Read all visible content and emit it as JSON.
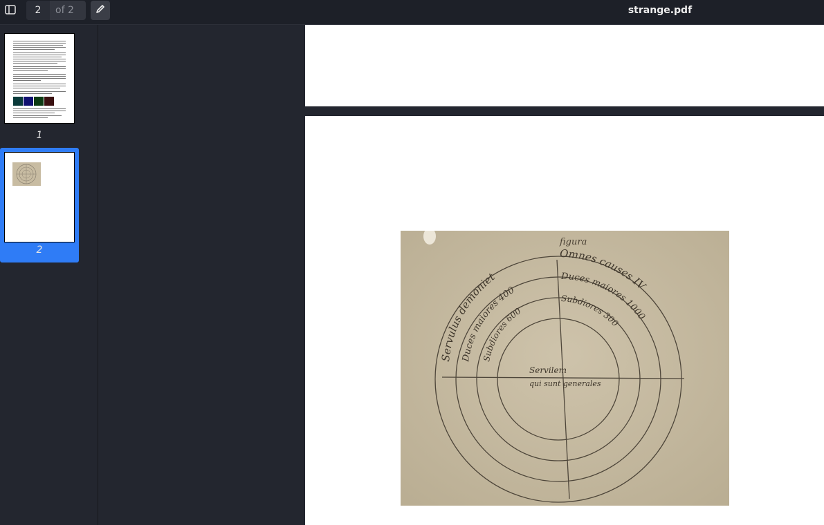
{
  "toolbar": {
    "current_page": "2",
    "page_count_label": "of 2",
    "document_title": "strange.pdf"
  },
  "sidebar": {
    "thumbnails": [
      {
        "label": "1",
        "selected": false
      },
      {
        "label": "2",
        "selected": true
      }
    ]
  },
  "document": {
    "figure_heading": "figura",
    "circle_text": {
      "outer_top_right": "Omnes causes IV",
      "outer_top_left": "Servulus demoniet",
      "ring2_top_right": "Duces maiores 1000",
      "ring2_top_left": "Duces maiores 400",
      "ring3_top_right": "Subdiores 300",
      "ring3_top_left": "Subdiores 600",
      "center_upper": "Servilem",
      "center_lower": "qui sunt generales"
    }
  },
  "colors": {
    "toolbar_bg": "#1d2028",
    "sidebar_bg": "#23262f",
    "selection_accent": "#2f7cf6",
    "parchment": "#c8bca2"
  }
}
